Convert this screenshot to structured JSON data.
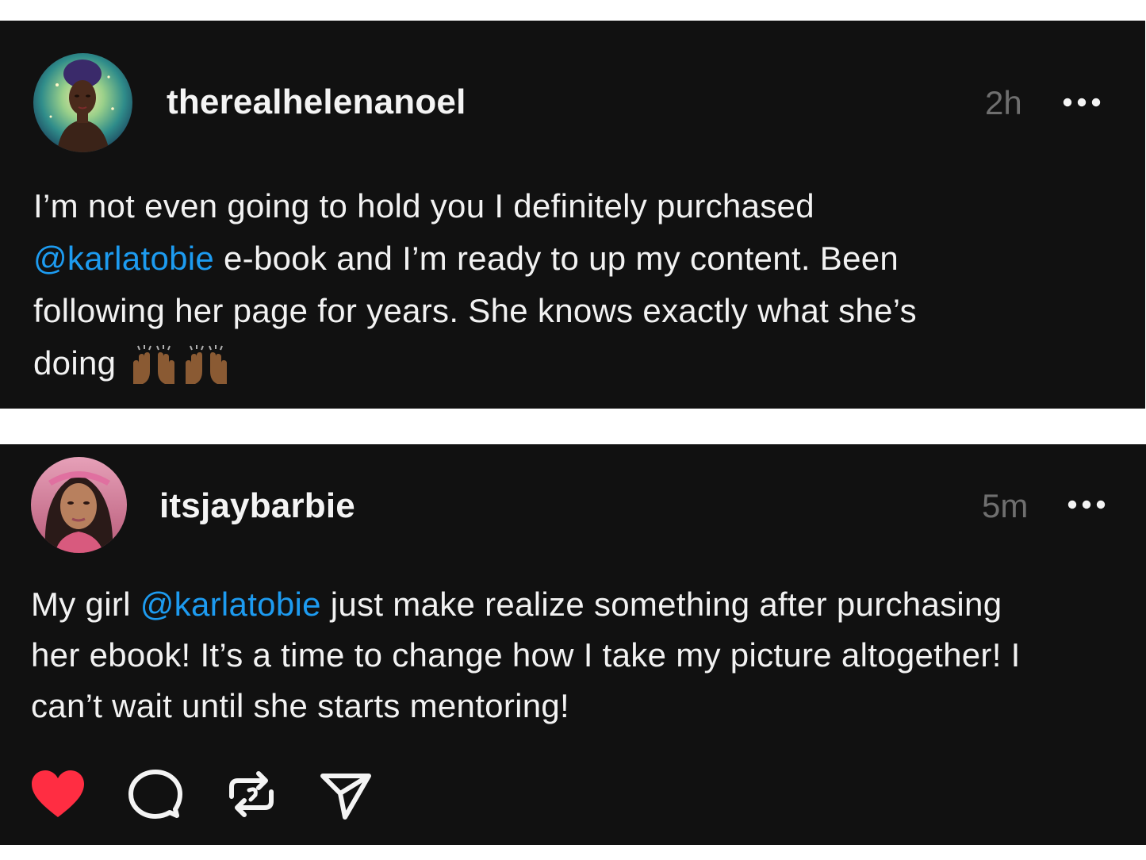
{
  "posts": [
    {
      "username": "therealhelenanoel",
      "time": "2h",
      "lines": [
        {
          "pre": "I’m not even going to hold you I definitely purchased",
          "mention": "",
          "post": ""
        },
        {
          "pre": "",
          "mention": "@karlatobie",
          "post": " e-book and I’m ready to up my content. Been"
        },
        {
          "pre": "following her page for years. She knows exactly what she’s",
          "mention": "",
          "post": ""
        },
        {
          "pre": "doing",
          "mention": "",
          "post": ""
        }
      ],
      "emoji": "raising-hands-icon"
    },
    {
      "username": "itsjaybarbie",
      "time": "5m",
      "lines": [
        {
          "pre": "My girl ",
          "mention": "@karlatobie",
          "post": " just make realize something after purchasing"
        },
        {
          "pre": "her ebook! It’s a time to change how I take my picture altogether! I",
          "mention": "",
          "post": ""
        },
        {
          "pre": "can’t wait until she starts mentoring!",
          "mention": "",
          "post": ""
        }
      ],
      "liked": true
    }
  ],
  "icons": {
    "more": "more-horizontal-icon",
    "like": "heart-icon",
    "reply": "speech-bubble-icon",
    "repost": "repost-icon",
    "share": "paper-plane-icon"
  },
  "colors": {
    "background": "#111111",
    "text": "#f2f2f2",
    "muted": "#6f6f6f",
    "mention": "#1d9bf0",
    "like": "#ff2d42"
  }
}
